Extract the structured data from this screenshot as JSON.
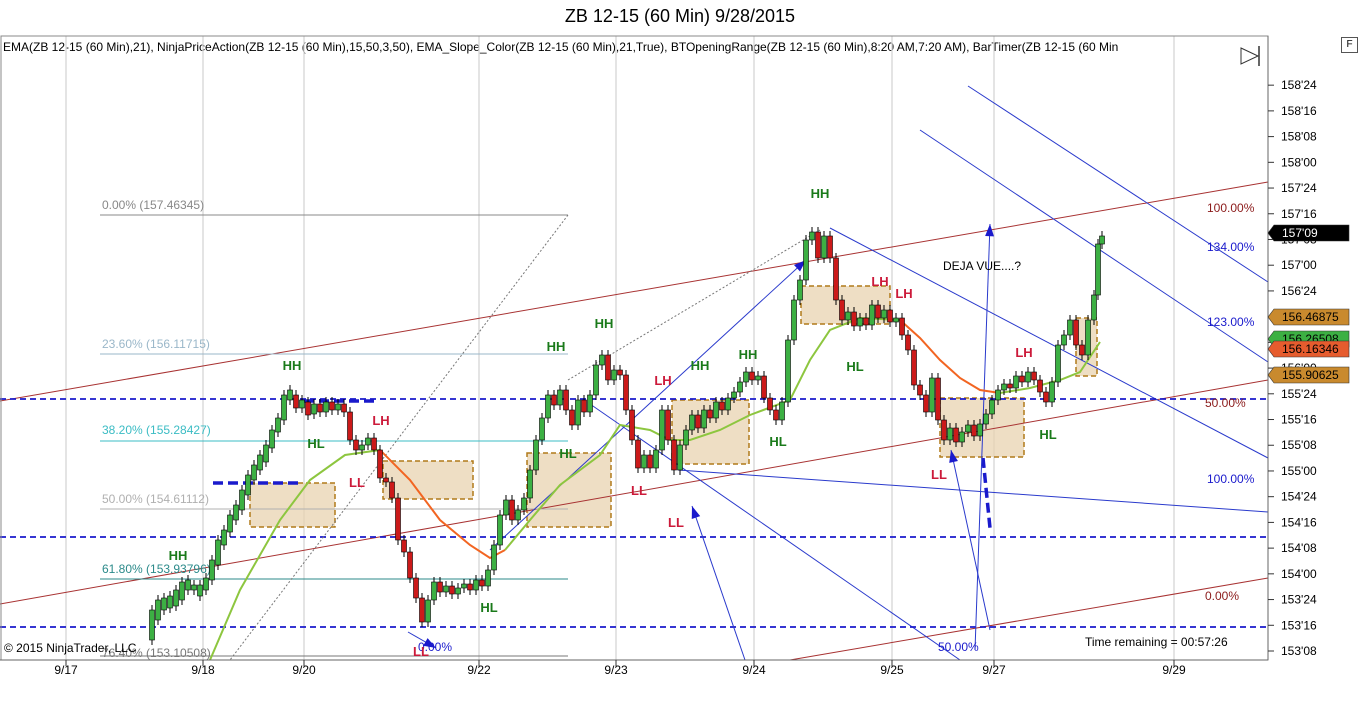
{
  "window": {
    "title": "ZB 12-15 (60 Min)  9/28/2015",
    "indicators": "EMA(ZB  12-15  (60  Min),21),  NinjaPriceAction(ZB  12-15  (60  Min),15,50,3,50),  EMA_Slope_Color(ZB  12-15  (60  Min),21,True),  BTOpeningRange(ZB  12-15  (60  Min),8:20  AM,7:20  AM),  BarTimer(ZB  12-15  (60  Min",
    "copyright": "© 2015 NinjaTrader, LLC",
    "time_remaining": "Time remaining = 00:57:26",
    "f_button": "F"
  },
  "chart_data": {
    "type": "candlestick",
    "instrument": "ZB 12-15",
    "timeframe": "60 Min",
    "y_axis": {
      "ticks": [
        "153'08",
        "153'16",
        "153'24",
        "154'00",
        "154'08",
        "154'16",
        "154'24",
        "155'00",
        "155'08",
        "155'16",
        "155'24",
        "156'00",
        "156'08",
        "156'16",
        "156'24",
        "157'00",
        "157'08",
        "157'16",
        "157'24",
        "158'00",
        "158'08",
        "158'16",
        "158'24"
      ],
      "range": [
        "153'06",
        "158'30"
      ]
    },
    "x_axis": {
      "ticks": [
        "9/17",
        "9/18",
        "9/20",
        "9/22",
        "9/23",
        "9/24",
        "9/25",
        "9/27",
        "9/29"
      ]
    },
    "price_markers": [
      {
        "label": "157'09",
        "bg": "#000000",
        "fg": "#ffffff"
      },
      {
        "label": "156.46875",
        "bg": "#c98a2e",
        "fg": "#000000"
      },
      {
        "label": "156.26508",
        "bg": "#3cb043",
        "fg": "#000000"
      },
      {
        "label": "156.16346",
        "bg": "#e65c2e",
        "fg": "#000000"
      },
      {
        "label": "155.90625",
        "bg": "#c98a2e",
        "fg": "#000000"
      }
    ],
    "fib_retracement": [
      {
        "label": "0.00% (157.46345)",
        "color": "#888888"
      },
      {
        "label": "23.60% (156.11715)",
        "color": "#9ab7c9"
      },
      {
        "label": "38.20% (155.28427)",
        "color": "#3bbcc4"
      },
      {
        "label": "50.00% (154.61112)",
        "color": "#b0b0b0"
      },
      {
        "label": "61.80% (153.93796)",
        "color": "#2b8a8a"
      },
      {
        "label": "76.40% (153.10508)",
        "color": "#777777"
      }
    ],
    "fib_right_labels": [
      {
        "label": "100.00%",
        "color": "#8b1a1a"
      },
      {
        "label": "134.00%",
        "color": "#1a1acc"
      },
      {
        "label": "123.00%",
        "color": "#1a1acc"
      },
      {
        "label": "50.00%",
        "color": "#8b1a1a"
      },
      {
        "label": "100.00%",
        "color": "#1a1acc"
      },
      {
        "label": "0.00%",
        "color": "#8b1a1a"
      },
      {
        "label": "50.00%",
        "color": "#1a1acc"
      },
      {
        "label": "0.00%",
        "color": "#1a1acc"
      }
    ],
    "swing_labels": [
      {
        "text": "HH",
        "color": "#1a7a1a"
      },
      {
        "text": "HH",
        "color": "#1a7a1a"
      },
      {
        "text": "HL",
        "color": "#1a7a1a"
      },
      {
        "text": "LH",
        "color": "#cc1a3a"
      },
      {
        "text": "LL",
        "color": "#cc1a3a"
      },
      {
        "text": "LL",
        "color": "#cc1a3a"
      },
      {
        "text": "HL",
        "color": "#1a7a1a"
      },
      {
        "text": "HH",
        "color": "#1a7a1a"
      },
      {
        "text": "HH",
        "color": "#1a7a1a"
      },
      {
        "text": "HL",
        "color": "#1a7a1a"
      },
      {
        "text": "LH",
        "color": "#cc1a3a"
      },
      {
        "text": "LL",
        "color": "#cc1a3a"
      },
      {
        "text": "LL",
        "color": "#cc1a3a"
      },
      {
        "text": "HH",
        "color": "#1a7a1a"
      },
      {
        "text": "HH",
        "color": "#1a7a1a"
      },
      {
        "text": "HL",
        "color": "#1a7a1a"
      },
      {
        "text": "HH",
        "color": "#1a7a1a"
      },
      {
        "text": "HL",
        "color": "#1a7a1a"
      },
      {
        "text": "LH",
        "color": "#cc1a3a"
      },
      {
        "text": "LH",
        "color": "#cc1a3a"
      },
      {
        "text": "LL",
        "color": "#cc1a3a"
      },
      {
        "text": "LH",
        "color": "#cc1a3a"
      },
      {
        "text": "HL",
        "color": "#1a7a1a"
      }
    ],
    "annotation": "DEJA VUE....?",
    "colors": {
      "up_candle": "#3cb043",
      "down_candle": "#cc1a1a",
      "ema_up": "#8dc63f",
      "ema_down": "#f26522",
      "opening_range_fill": "#e8d3b0",
      "opening_range_border": "#b07a1a",
      "support_lines": "#1a1acc",
      "channel_red": "#a83232",
      "channel_blue": "#2a3acc"
    }
  }
}
